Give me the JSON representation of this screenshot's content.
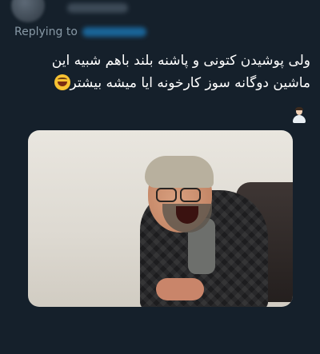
{
  "reply": {
    "label": "Replying to"
  },
  "tweet": {
    "line1": "ولی پوشیدن کتونی و پاشنه بلند باهم شبیه این",
    "line2": "ماشین دوگانه سوز کارخونه ایا میشه بیشتر"
  },
  "icons": {
    "laugh_emoji": "grinning-squinting-face-icon",
    "shrug_emoji": "person-shrugging-icon"
  },
  "colors": {
    "background": "#15202b",
    "secondary_text": "#8899a6",
    "accent": "#1d9bf0"
  }
}
